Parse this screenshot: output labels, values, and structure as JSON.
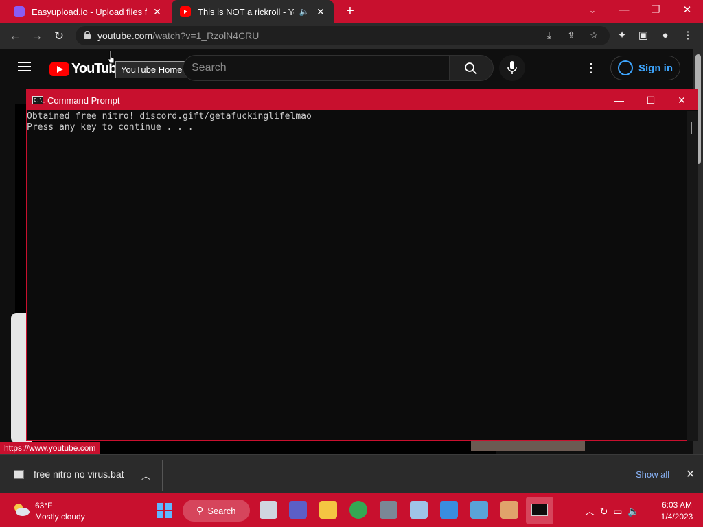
{
  "browser": {
    "tabs": [
      {
        "title": "Easyupload.io - Upload files for free",
        "favicon": "easyupload-icon"
      },
      {
        "title": "This is NOT a rickroll - YouTube",
        "favicon": "youtube-icon",
        "active": true,
        "audio": true
      }
    ],
    "url_host": "youtube.com",
    "url_path": "/watch?v=1_RzolN4CRU",
    "status_url": "https://www.youtube.com"
  },
  "youtube": {
    "logo_text": "YouTube",
    "tooltip": "YouTube Home",
    "search_placeholder": "Search",
    "sign_in": "Sign in"
  },
  "cmd": {
    "title": "Command Prompt",
    "lines": [
      "Obtained free nitro! discord.gift/getafuckinglifelmao",
      "Press any key to continue . . ."
    ]
  },
  "downloads": {
    "file_name": "free nitro no virus.bat",
    "show_all": "Show all"
  },
  "taskbar": {
    "temperature": "63°F",
    "condition": "Mostly cloudy",
    "search_label": "Search",
    "time": "6:03 AM",
    "date": "1/4/2023"
  },
  "colors": {
    "accent": "#c8102e",
    "youtube_red": "#ff0000",
    "link_blue": "#3ea6ff"
  }
}
